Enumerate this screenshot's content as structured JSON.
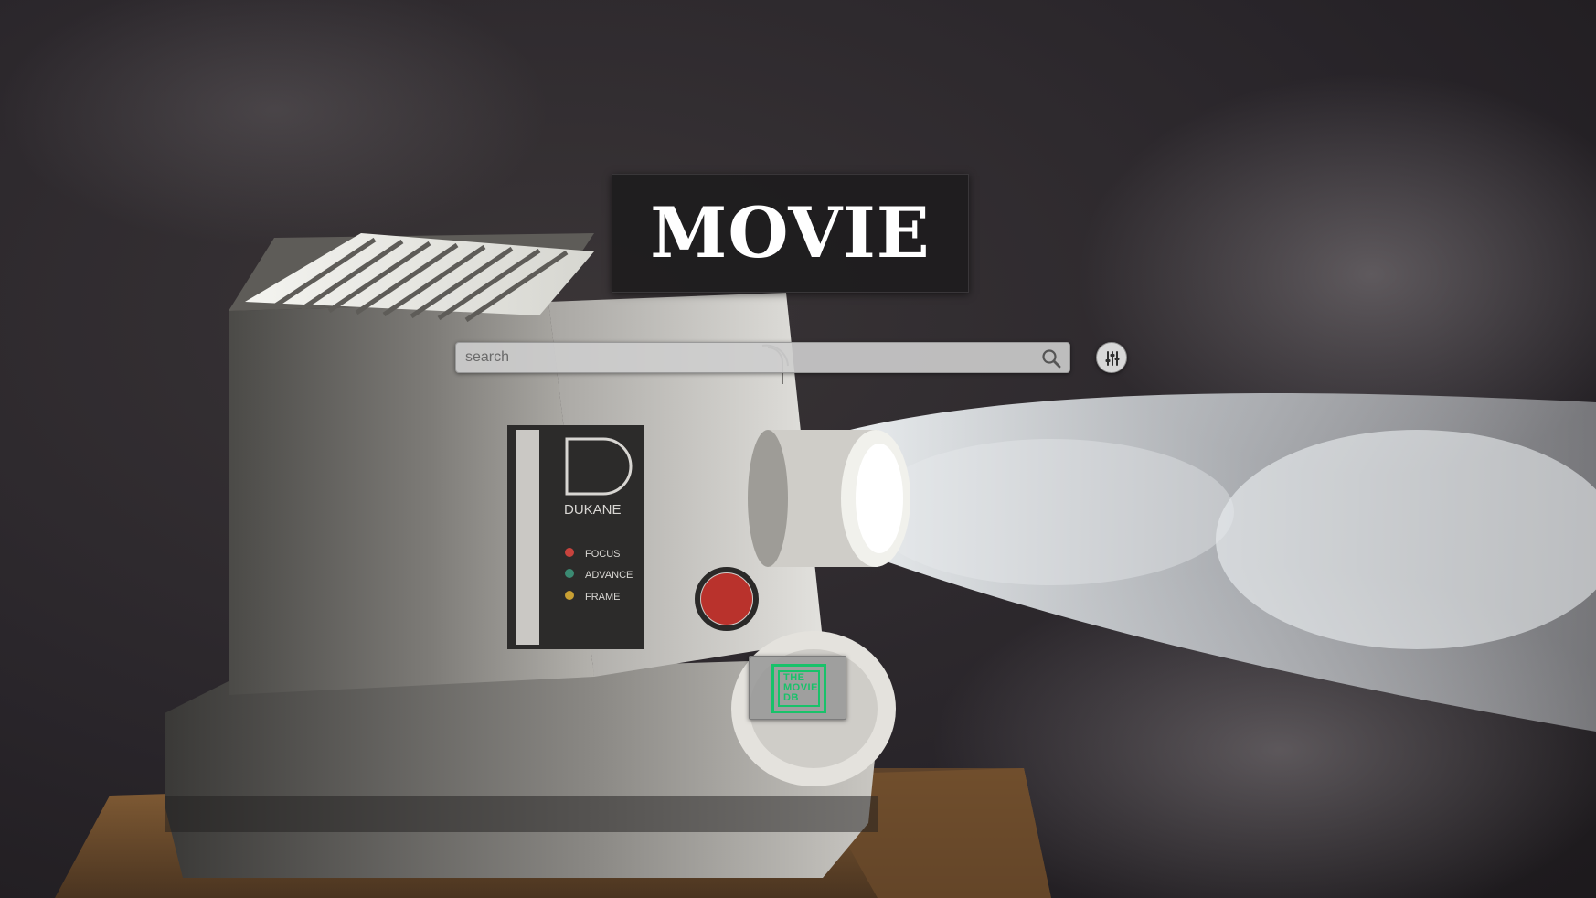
{
  "page": {
    "title": "MOVIE"
  },
  "search": {
    "placeholder": "search",
    "value": "",
    "icon": "search-icon"
  },
  "filter_button": {
    "icon": "sliders-icon"
  },
  "tmdb_badge": {
    "logo_lines": [
      "THE",
      "MOVIE",
      "DB"
    ],
    "logo_color": "#19c26a"
  },
  "background": {
    "camera_lines": [
      "DUKANE",
      "FOCUS",
      "ADVANCE",
      "FRAME"
    ],
    "colors": {
      "dark_wall": "#2a2628",
      "projector_body": "#8e8b86",
      "beam": "#e8eef2",
      "wood": "#6a4a2a"
    }
  }
}
